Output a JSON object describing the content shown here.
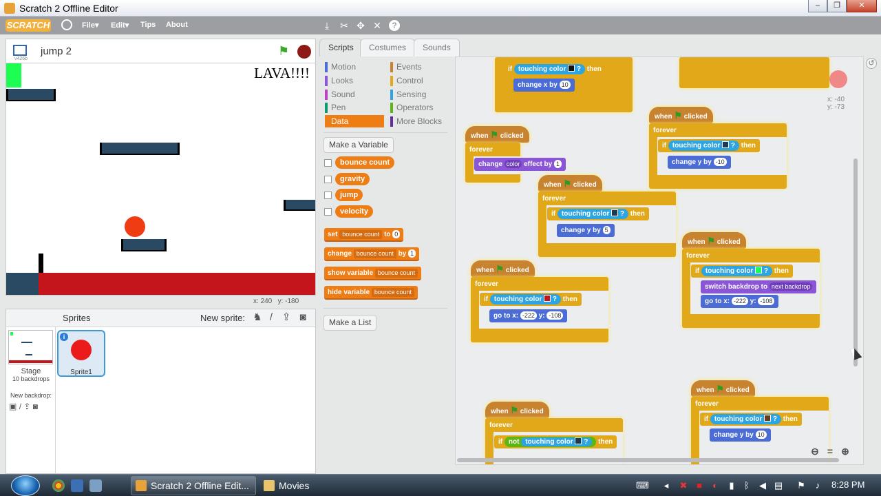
{
  "window": {
    "title": "Scratch 2 Offline Editor",
    "controls": [
      "–",
      "❐",
      "✕"
    ]
  },
  "menubar": {
    "logo": "SCRATCH",
    "items": [
      {
        "label": "File▾"
      },
      {
        "label": "Edit▾"
      },
      {
        "label": "Tips"
      },
      {
        "label": "About"
      }
    ],
    "tools": [
      "duplicate-icon",
      "delete-icon",
      "grow-icon",
      "shrink-icon",
      "help-icon"
    ]
  },
  "stage": {
    "project_title": "jump 2",
    "version": "v426b",
    "lava_text": "LAVA!!!!",
    "coords": {
      "x_label": "x:",
      "x": "240",
      "y_label": "y:",
      "y": "-180"
    },
    "colors": {
      "lava": "#c4141c",
      "platform": "#2a4a63",
      "ball": "#f03c12",
      "goal": "#1dfd52"
    }
  },
  "sprites_panel": {
    "title": "Sprites",
    "new_sprite_label": "New sprite:",
    "stage_label": "Stage",
    "backdrops": "10 backdrops",
    "new_backdrop_label": "New backdrop:",
    "sprites": [
      {
        "name": "Sprite1"
      }
    ]
  },
  "tabs": [
    {
      "label": "Scripts",
      "active": true
    },
    {
      "label": "Costumes"
    },
    {
      "label": "Sounds"
    }
  ],
  "palette": {
    "categories_left": [
      {
        "label": "Motion",
        "color": "#4a6cd4"
      },
      {
        "label": "Looks",
        "color": "#8a55d7"
      },
      {
        "label": "Sound",
        "color": "#bb42c3"
      },
      {
        "label": "Pen",
        "color": "#0e9a6c"
      },
      {
        "label": "Data",
        "color": "#ee7d16",
        "active": true
      }
    ],
    "categories_right": [
      {
        "label": "Events",
        "color": "#c88330"
      },
      {
        "label": "Control",
        "color": "#e1a91a"
      },
      {
        "label": "Sensing",
        "color": "#2ca5e2"
      },
      {
        "label": "Operators",
        "color": "#5cb712"
      },
      {
        "label": "More Blocks",
        "color": "#632d99"
      }
    ],
    "make_variable": "Make a Variable",
    "variables": [
      "bounce count",
      "gravity",
      "jump",
      "velocity"
    ],
    "set_block": {
      "label": "set",
      "var": "bounce count",
      "to": "to",
      "value": "0"
    },
    "change_block": {
      "label": "change",
      "var": "bounce count",
      "by": "by",
      "value": "1"
    },
    "show_block": {
      "label": "show variable",
      "var": "bounce count"
    },
    "hide_block": {
      "label": "hide variable",
      "var": "bounce count"
    },
    "make_list": "Make a List"
  },
  "scripts": {
    "when_clicked": "when",
    "clicked": "clicked",
    "forever": "forever",
    "if": "if",
    "then": "then",
    "touching_color": "touching color",
    "q": "?",
    "change_x_by": "change x by",
    "change_y_by": "change y by",
    "change_effect": "change",
    "effect_name": "color",
    "effect_by": "effect by",
    "go_to_x": "go to x:",
    "y_label": "y:",
    "switch_backdrop": "switch backdrop to",
    "next_backdrop": "next backdrop",
    "not": "not",
    "values": {
      "change_x": "10",
      "effect": "1",
      "change_y_a": "5",
      "change_y_b": "-10",
      "goto_x": "-222",
      "goto_y": "-108",
      "change_y_c": "10"
    },
    "swatch_colors": {
      "black": "#111111",
      "navy": "#1f3a52",
      "red": "#c4141c",
      "green": "#1dfd52",
      "brown": "#6a3b1f"
    },
    "readout": {
      "x": "x: -40",
      "y": "y: -73"
    }
  },
  "taskbar": {
    "buttons": [
      {
        "label": "Scratch 2 Offline Edit..."
      },
      {
        "label": "Movies"
      }
    ],
    "clock": "8:28 PM"
  }
}
